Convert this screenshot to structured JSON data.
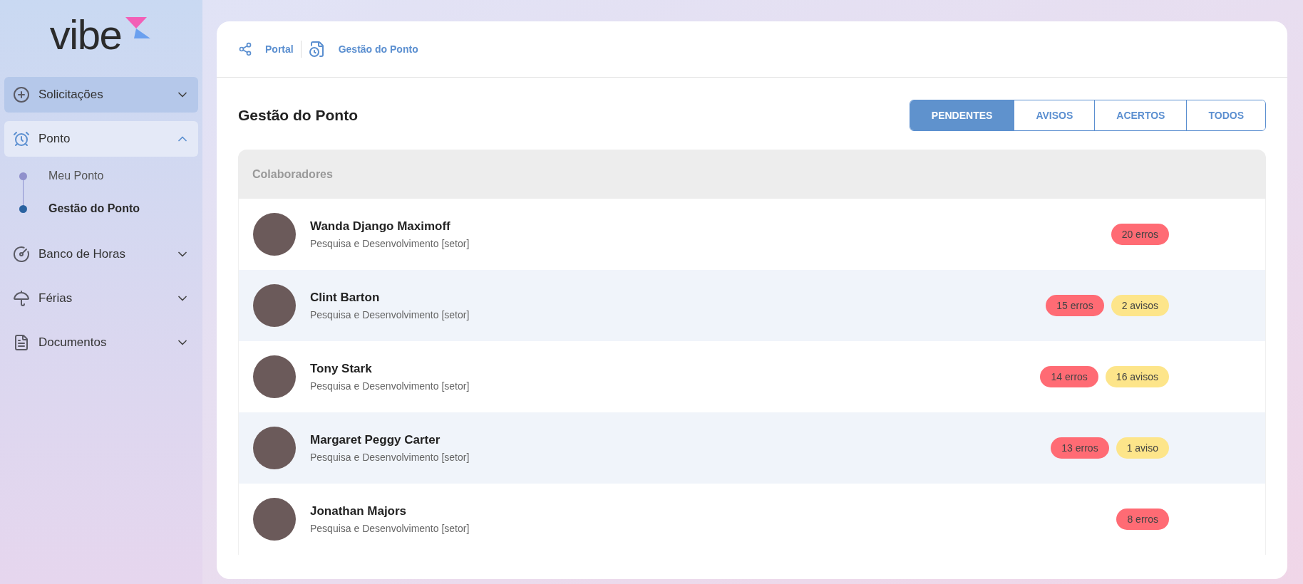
{
  "logo": {
    "text": "vibe"
  },
  "sidebar": {
    "items": [
      {
        "label": "Solicitações",
        "expanded": false,
        "hovered": true
      },
      {
        "label": "Ponto",
        "expanded": true,
        "hovered": false,
        "children": [
          {
            "label": "Meu Ponto",
            "selected": false
          },
          {
            "label": "Gestão do Ponto",
            "selected": true
          }
        ]
      },
      {
        "label": "Banco de Horas",
        "expanded": false,
        "hovered": false
      },
      {
        "label": "Férias",
        "expanded": false,
        "hovered": false
      },
      {
        "label": "Documentos",
        "expanded": false,
        "hovered": false
      }
    ]
  },
  "breadcrumb": [
    {
      "label": "Portal"
    },
    {
      "label": "Gestão do Ponto"
    }
  ],
  "page_title": "Gestão do Ponto",
  "tabs": [
    {
      "label": "PENDENTES",
      "selected": true
    },
    {
      "label": "AVISOS",
      "selected": false
    },
    {
      "label": "ACERTOS",
      "selected": false
    },
    {
      "label": "TODOS",
      "selected": false
    }
  ],
  "table": {
    "header": "Colaboradores",
    "rows": [
      {
        "name": "Wanda Django Maximoff",
        "department": "Pesquisa e Desenvolvimento [setor]",
        "badges": [
          {
            "kind": "error",
            "label": "20 erros"
          }
        ]
      },
      {
        "name": "Clint Barton",
        "department": "Pesquisa e Desenvolvimento [setor]",
        "badges": [
          {
            "kind": "error",
            "label": "15 erros"
          },
          {
            "kind": "warning",
            "label": "2 avisos"
          }
        ]
      },
      {
        "name": "Tony Stark",
        "department": "Pesquisa e Desenvolvimento [setor]",
        "badges": [
          {
            "kind": "error",
            "label": "14 erros"
          },
          {
            "kind": "warning",
            "label": "16 avisos"
          }
        ]
      },
      {
        "name": "Margaret Peggy Carter",
        "department": "Pesquisa e Desenvolvimento [setor]",
        "badges": [
          {
            "kind": "error",
            "label": "13 erros"
          },
          {
            "kind": "warning",
            "label": "1 aviso"
          }
        ]
      },
      {
        "name": "Jonathan Majors",
        "department": "Pesquisa e Desenvolvimento [setor]",
        "badges": [
          {
            "kind": "error",
            "label": "8 erros"
          }
        ]
      }
    ]
  }
}
